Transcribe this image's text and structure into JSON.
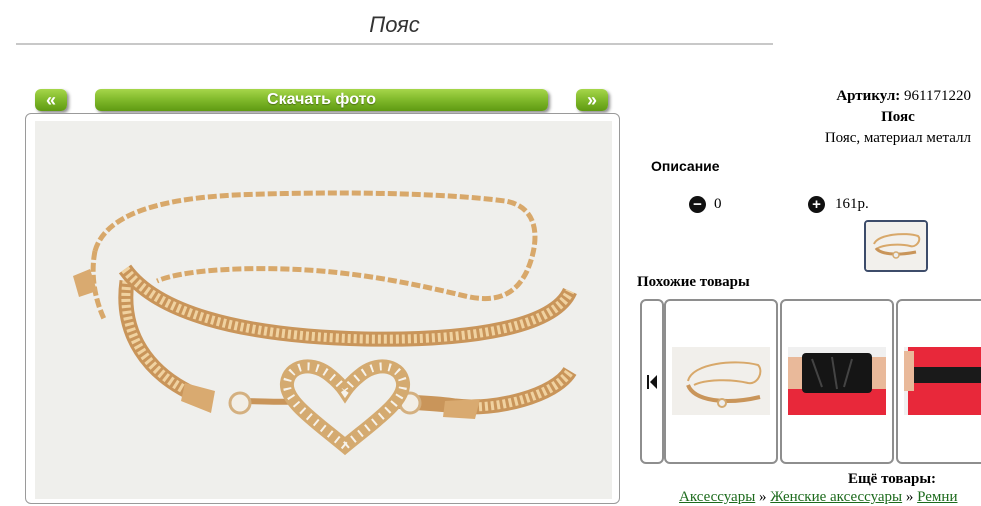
{
  "page": {
    "title": "Пояс"
  },
  "photo_nav": {
    "prev_label": "«",
    "download_label": "Скачать фото",
    "next_label": "»"
  },
  "product": {
    "article_label": "Артикул:",
    "article_number": "961171220",
    "name": "Пояс",
    "description_short": "Пояс, материал металл",
    "description_label": "Описание"
  },
  "quantity": {
    "minus_icon": "minus-circle-icon",
    "value": "0",
    "plus_icon": "plus-circle-icon",
    "price": "161р."
  },
  "similar": {
    "label": "Похожие товары",
    "items": [
      {
        "name": "gold-chain-belt"
      },
      {
        "name": "black-corset-belt"
      },
      {
        "name": "black-belt-red-dress"
      }
    ]
  },
  "more": {
    "label": "Ещё товары:",
    "breadcrumbs": [
      "Аксессуары",
      "Женские аксессуары",
      "Ремни"
    ],
    "separator": " » "
  },
  "colors": {
    "green_button": "#7fb82a",
    "link_green": "#1d6b1d",
    "photo_bg": "#efefec"
  }
}
